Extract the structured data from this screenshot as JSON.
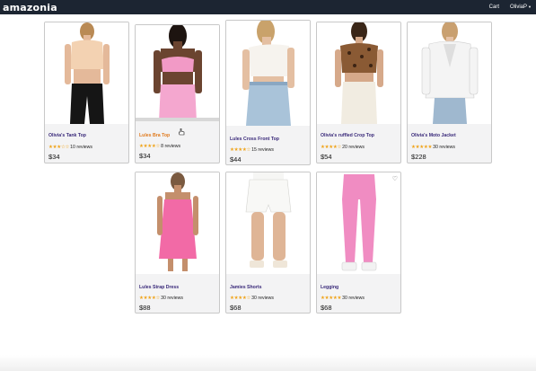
{
  "nav": {
    "brand": "amazonia",
    "cart": "Cart",
    "user": "OliviaP"
  },
  "colors": {
    "navbar": "#1c2532",
    "name_link": "#3a2a7a",
    "name_hover": "#e07a1e",
    "star": "#f0a41a",
    "card_bg": "#f3f3f4"
  },
  "products": [
    {
      "name": "Olivia's Tank Top",
      "stars": "★★★☆☆",
      "reviews": "10 reviews",
      "price": "$34",
      "rating": 3
    },
    {
      "name": "Lules Bra Top",
      "stars": "★★★★☆",
      "reviews": "8 reviews",
      "price": "$34",
      "rating": 4
    },
    {
      "name": "Lules Cross Front Top",
      "stars": "★★★★☆",
      "reviews": "15 reviews",
      "price": "$44",
      "rating": 4
    },
    {
      "name": "Olivia's ruffled Crop Top",
      "stars": "★★★★☆",
      "reviews": "20 reviews",
      "price": "$54",
      "rating": 4
    },
    {
      "name": "Olivia's Moto Jacket",
      "stars": "★★★★★",
      "reviews": "30 reviews",
      "price": "$228",
      "rating": 5
    },
    {
      "name": "Lules Strap Dress",
      "stars": "★★★★☆",
      "reviews": "30 reviews",
      "price": "$88",
      "rating": 4
    },
    {
      "name": "Jamies Shorts",
      "stars": "★★★★☆",
      "reviews": "30 reviews",
      "price": "$68",
      "rating": 4
    },
    {
      "name": "Legging",
      "stars": "★★★★★",
      "reviews": "30 reviews",
      "price": "$68",
      "rating": 5
    }
  ],
  "icons": {
    "heart": "♡",
    "caret": "▼"
  }
}
